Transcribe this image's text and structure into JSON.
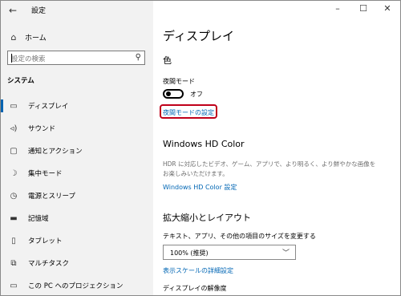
{
  "window": {
    "title": "設定",
    "back_icon": "back-arrow-icon",
    "minimize": "–",
    "maximize": "☐",
    "close": "✕"
  },
  "sidebar": {
    "home_label": "ホーム",
    "search_placeholder": "設定の検索",
    "section_title": "システム",
    "items": [
      {
        "label": "ディスプレイ",
        "icon": "monitor-icon",
        "glyph": "▭",
        "active": true
      },
      {
        "label": "サウンド",
        "icon": "speaker-icon",
        "glyph": "🔈︎",
        "active": false
      },
      {
        "label": "通知とアクション",
        "icon": "notification-icon",
        "glyph": "▢",
        "active": false
      },
      {
        "label": "集中モード",
        "icon": "moon-icon",
        "glyph": "☽",
        "active": false
      },
      {
        "label": "電源とスリープ",
        "icon": "power-icon",
        "glyph": "⏻",
        "active": false
      },
      {
        "label": "記憶域",
        "icon": "storage-icon",
        "glyph": "▬",
        "active": false
      },
      {
        "label": "タブレット",
        "icon": "tablet-icon",
        "glyph": "▯",
        "active": false
      },
      {
        "label": "マルチタスク",
        "icon": "multitask-icon",
        "glyph": "⧉",
        "active": false
      },
      {
        "label": "この PC へのプロジェクション",
        "icon": "projection-icon",
        "glyph": "▭",
        "active": false
      }
    ]
  },
  "main": {
    "page_title": "ディスプレイ",
    "color_section": "色",
    "night_mode_label": "夜間モード",
    "night_mode_state": "オフ",
    "night_mode_settings_link": "夜間モードの設定",
    "hd_color_section": "Windows HD Color",
    "hd_color_desc": "HDR に対応したビデオ、ゲーム、アプリで、より明るく、より鮮やかな画像をお楽しみいただけます。",
    "hd_color_link": "Windows HD Color 設定",
    "scale_section": "拡大縮小とレイアウト",
    "scale_label": "テキスト、アプリ、その他の項目のサイズを変更する",
    "scale_value": "100% (推奨)",
    "advanced_scale_link": "表示スケールの詳細設定",
    "resolution_label": "ディスプレイの解像度"
  }
}
